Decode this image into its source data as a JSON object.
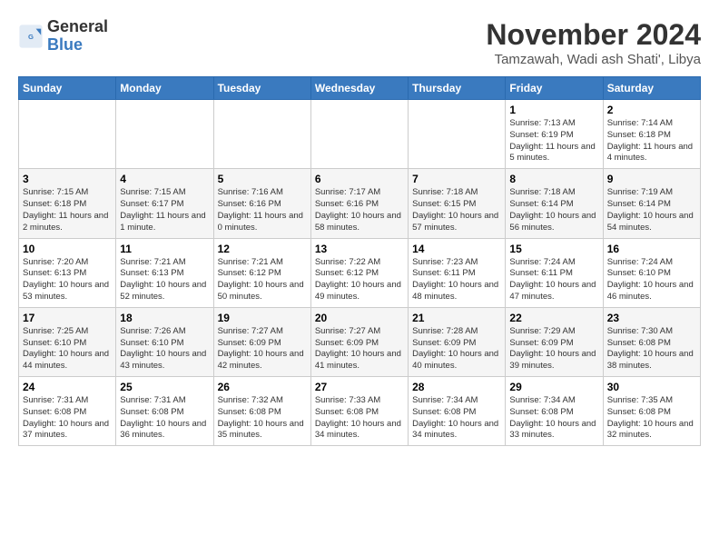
{
  "logo": {
    "line1": "General",
    "line2": "Blue"
  },
  "title": "November 2024",
  "location": "Tamzawah, Wadi ash Shati', Libya",
  "weekdays": [
    "Sunday",
    "Monday",
    "Tuesday",
    "Wednesday",
    "Thursday",
    "Friday",
    "Saturday"
  ],
  "weeks": [
    [
      {
        "day": "",
        "info": ""
      },
      {
        "day": "",
        "info": ""
      },
      {
        "day": "",
        "info": ""
      },
      {
        "day": "",
        "info": ""
      },
      {
        "day": "",
        "info": ""
      },
      {
        "day": "1",
        "info": "Sunrise: 7:13 AM\nSunset: 6:19 PM\nDaylight: 11 hours and 5 minutes."
      },
      {
        "day": "2",
        "info": "Sunrise: 7:14 AM\nSunset: 6:18 PM\nDaylight: 11 hours and 4 minutes."
      }
    ],
    [
      {
        "day": "3",
        "info": "Sunrise: 7:15 AM\nSunset: 6:18 PM\nDaylight: 11 hours and 2 minutes."
      },
      {
        "day": "4",
        "info": "Sunrise: 7:15 AM\nSunset: 6:17 PM\nDaylight: 11 hours and 1 minute."
      },
      {
        "day": "5",
        "info": "Sunrise: 7:16 AM\nSunset: 6:16 PM\nDaylight: 11 hours and 0 minutes."
      },
      {
        "day": "6",
        "info": "Sunrise: 7:17 AM\nSunset: 6:16 PM\nDaylight: 10 hours and 58 minutes."
      },
      {
        "day": "7",
        "info": "Sunrise: 7:18 AM\nSunset: 6:15 PM\nDaylight: 10 hours and 57 minutes."
      },
      {
        "day": "8",
        "info": "Sunrise: 7:18 AM\nSunset: 6:14 PM\nDaylight: 10 hours and 56 minutes."
      },
      {
        "day": "9",
        "info": "Sunrise: 7:19 AM\nSunset: 6:14 PM\nDaylight: 10 hours and 54 minutes."
      }
    ],
    [
      {
        "day": "10",
        "info": "Sunrise: 7:20 AM\nSunset: 6:13 PM\nDaylight: 10 hours and 53 minutes."
      },
      {
        "day": "11",
        "info": "Sunrise: 7:21 AM\nSunset: 6:13 PM\nDaylight: 10 hours and 52 minutes."
      },
      {
        "day": "12",
        "info": "Sunrise: 7:21 AM\nSunset: 6:12 PM\nDaylight: 10 hours and 50 minutes."
      },
      {
        "day": "13",
        "info": "Sunrise: 7:22 AM\nSunset: 6:12 PM\nDaylight: 10 hours and 49 minutes."
      },
      {
        "day": "14",
        "info": "Sunrise: 7:23 AM\nSunset: 6:11 PM\nDaylight: 10 hours and 48 minutes."
      },
      {
        "day": "15",
        "info": "Sunrise: 7:24 AM\nSunset: 6:11 PM\nDaylight: 10 hours and 47 minutes."
      },
      {
        "day": "16",
        "info": "Sunrise: 7:24 AM\nSunset: 6:10 PM\nDaylight: 10 hours and 46 minutes."
      }
    ],
    [
      {
        "day": "17",
        "info": "Sunrise: 7:25 AM\nSunset: 6:10 PM\nDaylight: 10 hours and 44 minutes."
      },
      {
        "day": "18",
        "info": "Sunrise: 7:26 AM\nSunset: 6:10 PM\nDaylight: 10 hours and 43 minutes."
      },
      {
        "day": "19",
        "info": "Sunrise: 7:27 AM\nSunset: 6:09 PM\nDaylight: 10 hours and 42 minutes."
      },
      {
        "day": "20",
        "info": "Sunrise: 7:27 AM\nSunset: 6:09 PM\nDaylight: 10 hours and 41 minutes."
      },
      {
        "day": "21",
        "info": "Sunrise: 7:28 AM\nSunset: 6:09 PM\nDaylight: 10 hours and 40 minutes."
      },
      {
        "day": "22",
        "info": "Sunrise: 7:29 AM\nSunset: 6:09 PM\nDaylight: 10 hours and 39 minutes."
      },
      {
        "day": "23",
        "info": "Sunrise: 7:30 AM\nSunset: 6:08 PM\nDaylight: 10 hours and 38 minutes."
      }
    ],
    [
      {
        "day": "24",
        "info": "Sunrise: 7:31 AM\nSunset: 6:08 PM\nDaylight: 10 hours and 37 minutes."
      },
      {
        "day": "25",
        "info": "Sunrise: 7:31 AM\nSunset: 6:08 PM\nDaylight: 10 hours and 36 minutes."
      },
      {
        "day": "26",
        "info": "Sunrise: 7:32 AM\nSunset: 6:08 PM\nDaylight: 10 hours and 35 minutes."
      },
      {
        "day": "27",
        "info": "Sunrise: 7:33 AM\nSunset: 6:08 PM\nDaylight: 10 hours and 34 minutes."
      },
      {
        "day": "28",
        "info": "Sunrise: 7:34 AM\nSunset: 6:08 PM\nDaylight: 10 hours and 34 minutes."
      },
      {
        "day": "29",
        "info": "Sunrise: 7:34 AM\nSunset: 6:08 PM\nDaylight: 10 hours and 33 minutes."
      },
      {
        "day": "30",
        "info": "Sunrise: 7:35 AM\nSunset: 6:08 PM\nDaylight: 10 hours and 32 minutes."
      }
    ]
  ]
}
